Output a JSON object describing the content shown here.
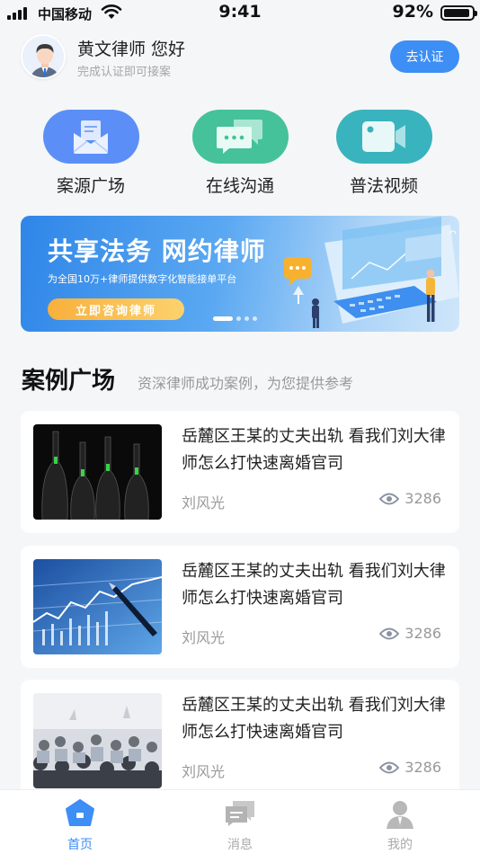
{
  "status_bar": {
    "carrier": "中国移动",
    "time": "9:41",
    "battery": "92%",
    "battery_level": 0.92
  },
  "header": {
    "greeting": "黄文律师 您好",
    "subtitle": "完成认证即可接案",
    "verify_label": "去认证"
  },
  "quick_actions": [
    {
      "label": "案源广场",
      "icon": "envelope-icon",
      "color": "#5b8ff7"
    },
    {
      "label": "在线沟通",
      "icon": "chat-bubbles-icon",
      "color": "#45c29a"
    },
    {
      "label": "普法视频",
      "icon": "video-camera-icon",
      "color": "#39b3bd"
    }
  ],
  "banner": {
    "title": "共享法务 网约律师",
    "subtitle": "为全国10万+律师提供数字化智能接单平台",
    "cta": "立即咨询律师",
    "slide_count": 4,
    "active_slide": 1
  },
  "section": {
    "title": "案例广场",
    "description": "资深律师成功案例，为您提供参考"
  },
  "cases": [
    {
      "title": "岳麓区王某的丈夫出轨 看我们刘大律师怎么打快速离婚官司",
      "author": "刘风光",
      "views": "3286",
      "thumb": "bottles-photo"
    },
    {
      "title": "岳麓区王某的丈夫出轨 看我们刘大律师怎么打快速离婚官司",
      "author": "刘风光",
      "views": "3286",
      "thumb": "stock-chart-photo"
    },
    {
      "title": "岳麓区王某的丈夫出轨 看我们刘大律师怎么打快速离婚官司",
      "author": "刘风光",
      "views": "3286",
      "thumb": "audience-photo"
    }
  ],
  "tabbar": [
    {
      "label": "首页",
      "icon": "home-icon",
      "active": true
    },
    {
      "label": "消息",
      "icon": "message-icon",
      "active": false
    },
    {
      "label": "我的",
      "icon": "profile-icon",
      "active": false
    }
  ],
  "colors": {
    "accent": "#3d8ef5",
    "background": "#f5f6f8",
    "muted_text": "#999999"
  }
}
